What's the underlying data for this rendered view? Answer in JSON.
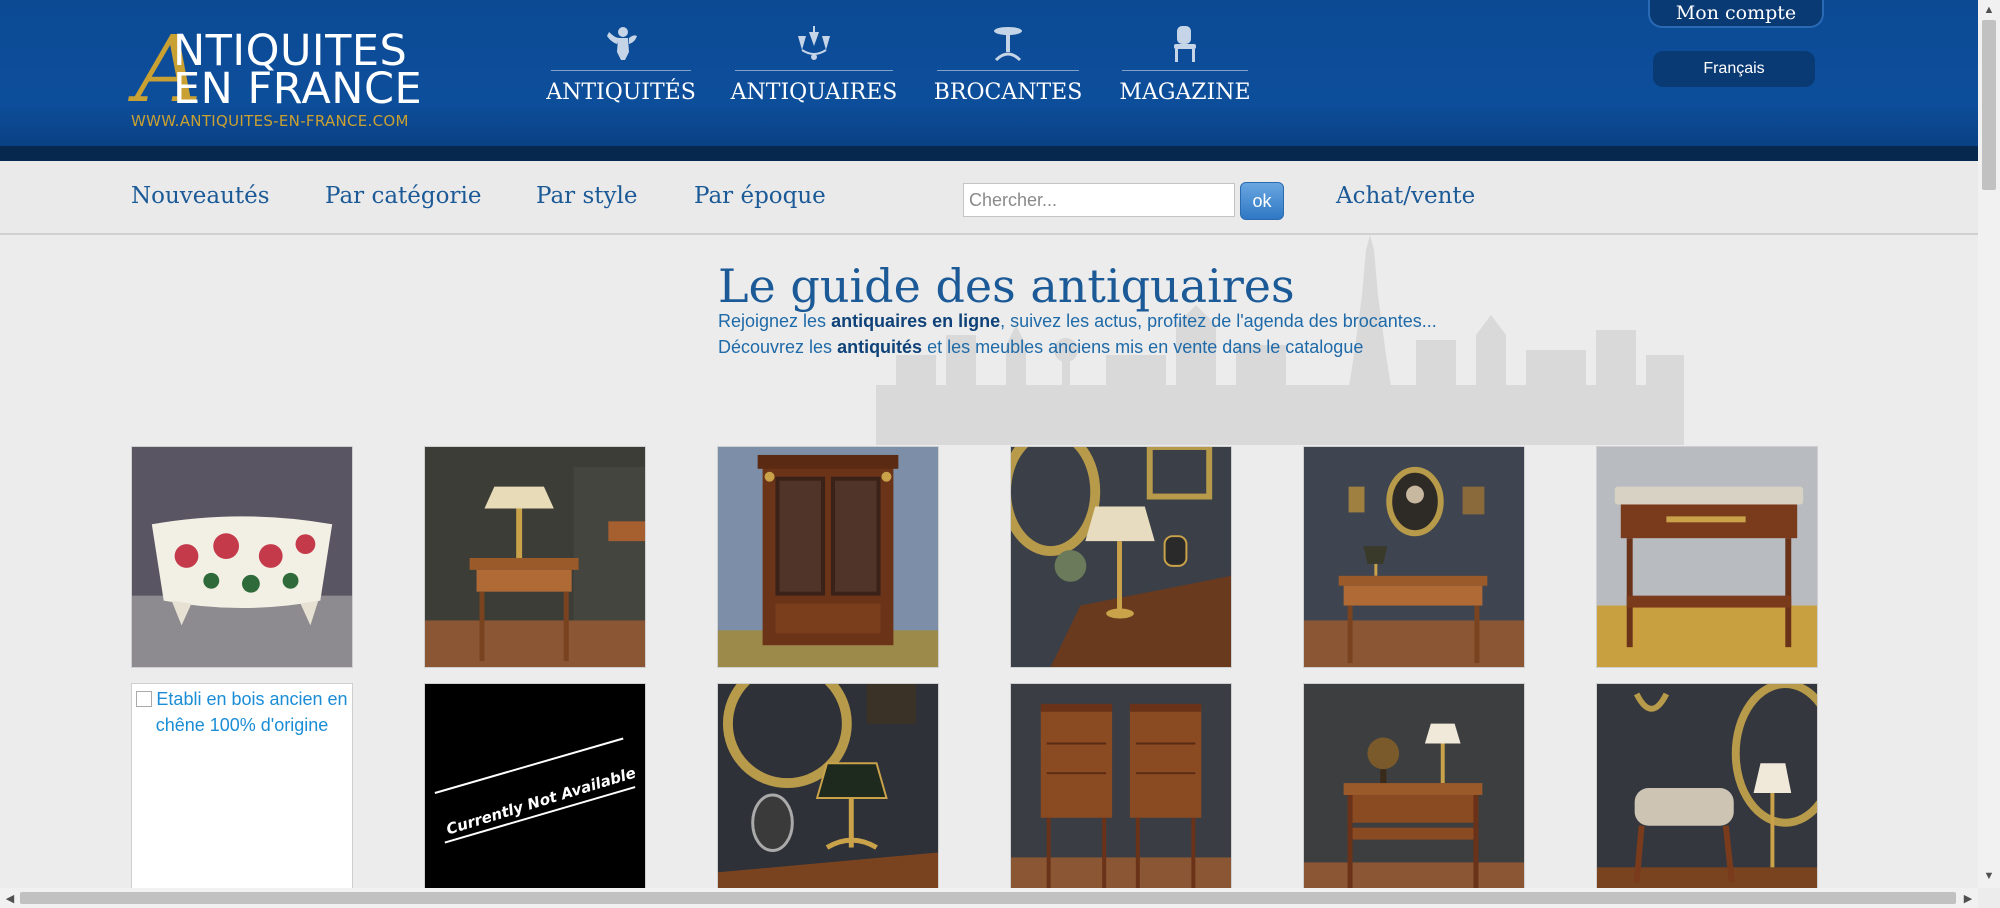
{
  "logo": {
    "big_letter": "A",
    "line1": "NTIQUITES",
    "line2": "EN FRANCE",
    "url": "WWW.ANTIQUITES-EN-FRANCE.COM"
  },
  "main_nav": [
    {
      "label": "ANTIQUITÉS",
      "icon": "cherub-icon"
    },
    {
      "label": "ANTIQUAIRES",
      "icon": "chandelier-icon"
    },
    {
      "label": "BROCANTES",
      "icon": "pedestal-table-icon"
    },
    {
      "label": "MAGAZINE",
      "icon": "chair-icon"
    }
  ],
  "account": {
    "label": "Mon compte"
  },
  "language": {
    "label": "Français"
  },
  "sub_nav": [
    {
      "label": "Nouveautés"
    },
    {
      "label": "Par catégorie"
    },
    {
      "label": "Par style"
    },
    {
      "label": "Par époque"
    },
    {
      "label": "Achat/vente"
    }
  ],
  "search": {
    "placeholder": "Chercher...",
    "button": "ok"
  },
  "intro": {
    "title": "Le guide des antiquaires",
    "line1_pre": "Rejoignez les ",
    "line1_bold": "antiquaires en ligne",
    "line1_post": ", suivez les actus, profitez de l'agenda des brocantes...",
    "line2_pre": "Découvrez les ",
    "line2_bold": "antiquités",
    "line2_post": " et les meubles anciens mis en vente dans le catalogue"
  },
  "products": {
    "broken_alt": "Etabli en bois ancien en chêne 100% d'origine",
    "not_available": "Currently Not Available"
  },
  "colors": {
    "header_blue": "#0d4e9b",
    "header_dark": "#06284f",
    "link_blue": "#1b5a97",
    "gold": "#c9a032"
  }
}
